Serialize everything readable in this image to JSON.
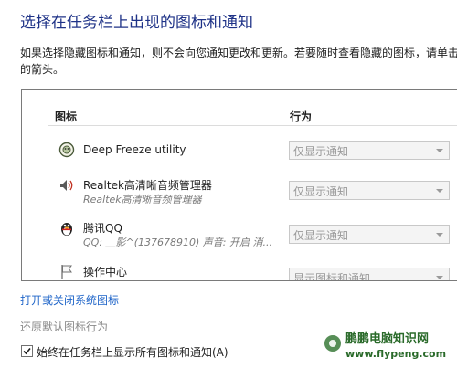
{
  "page": {
    "title": "选择在任务栏上出现的图标和通知",
    "description_line1": "如果选择隐藏图标和通知，则不会向您通知更改和更新。若要随时查看隐藏的图标，请单击",
    "description_line2": "的箭头。"
  },
  "table": {
    "col_icons": "图标",
    "col_behavior": "行为",
    "rows": [
      {
        "name": "Deep Freeze utility",
        "subtitle": "",
        "behavior": "仅显示通知",
        "icon": "deep-freeze-icon"
      },
      {
        "name": "Realtek高清晰音频管理器",
        "subtitle": "Realtek高清晰音频管理器",
        "behavior": "仅显示通知",
        "icon": "speaker-icon"
      },
      {
        "name": "腾讯QQ",
        "subtitle": "QQ: ＿影^(137678910)  声音: 开启  消...",
        "behavior": "仅显示通知",
        "icon": "qq-penguin-icon"
      },
      {
        "name": "操作中心",
        "subtitle": "",
        "behavior": "显示图标和通知",
        "icon": "flag-icon"
      }
    ]
  },
  "links": {
    "system_icons": "打开或关闭系统图标",
    "restore_defaults": "还原默认图标行为"
  },
  "checkbox": {
    "label": "始终在任务栏上显示所有图标和通知(A)",
    "checked": true
  },
  "watermark": {
    "title": "鹏鹏电脑知识网",
    "url": "www.flypeng.com"
  },
  "colors": {
    "title": "#1e3287",
    "link": "#1e64c8",
    "disabled": "#8a8a8a"
  }
}
